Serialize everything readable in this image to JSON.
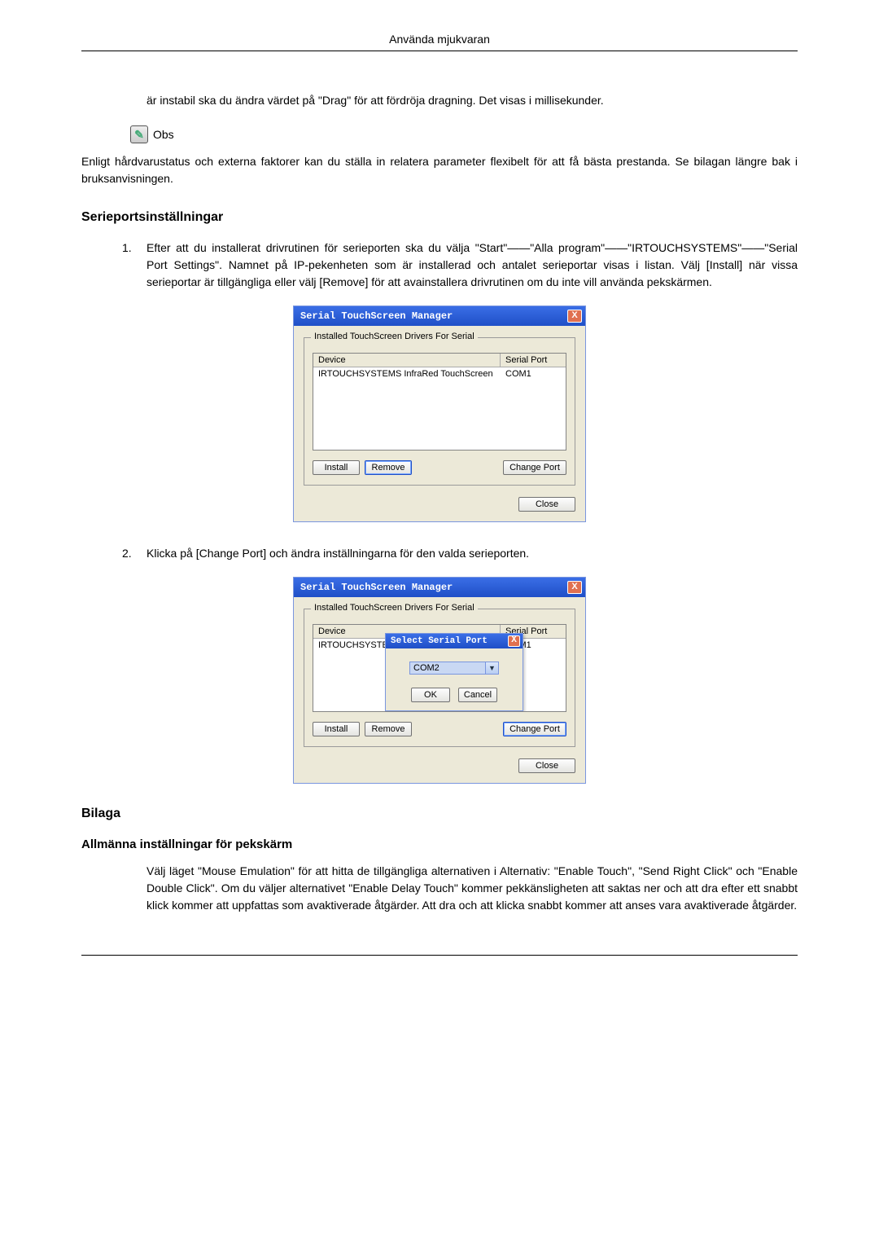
{
  "header": {
    "title": "Använda mjukvaran"
  },
  "intro_paragraph": "är instabil ska du ändra värdet på \"Drag\" för att fördröja dragning. Det visas i millisekunder.",
  "note": {
    "icon_glyph": "✎",
    "label": "Obs",
    "body": "Enligt hårdvarustatus och externa faktorer kan du ställa in relatera parameter flexibelt för att få bästa prestanda. Se bilagan längre bak i bruksanvisningen."
  },
  "section_serial": {
    "heading": "Serieportsinställningar",
    "item1_num": "1.",
    "item1_text": "Efter att du installerat drivrutinen för serieporten ska du välja \"Start\"——\"Alla program\"——\"IRTOUCHSYSTEMS\"——\"Serial Port Settings\". Namnet på IP-pekenheten som är installerad och antalet serieportar visas i listan. Välj [Install] när vissa serieportar är tillgängliga eller välj [Remove] för att avainstallera drivrutinen om du inte vill använda pekskärmen.",
    "item2_num": "2.",
    "item2_text": "Klicka på [Change Port] och ändra inställningarna för den valda serieporten."
  },
  "dialog1": {
    "title": "Serial TouchScreen Manager",
    "group_label": "Installed TouchScreen Drivers For Serial",
    "col_device": "Device",
    "col_port": "Serial Port",
    "row_device": "IRTOUCHSYSTEMS InfraRed TouchScreen",
    "row_port": "COM1",
    "btn_install": "Install",
    "btn_remove": "Remove",
    "btn_change": "Change Port",
    "btn_close": "Close",
    "close_x": "X"
  },
  "dialog2": {
    "title": "Serial TouchScreen Manager",
    "group_label": "Installed TouchScreen Drivers For Serial",
    "col_device": "Device",
    "col_port": "Serial Port",
    "row_device": "IRTOUCHSYSTE",
    "row_port": "COM1",
    "btn_install": "Install",
    "btn_remove": "Remove",
    "btn_change": "Change Port",
    "btn_close": "Close",
    "close_x": "X",
    "inner_title": "Select Serial Port",
    "inner_close_x": "X",
    "combo_value": "COM2",
    "combo_arrow": "▼",
    "btn_ok": "OK",
    "btn_cancel": "Cancel"
  },
  "bilaga": {
    "heading": "Bilaga",
    "subheading": "Allmänna inställningar för pekskärm",
    "body": "Välj läget \"Mouse Emulation\" för att hitta de tillgängliga alternativen i Alternativ: \"Enable Touch\", \"Send Right Click\" och \"Enable Double Click\". Om du väljer alternativet \"Enable Delay Touch\" kommer pekkänsligheten att saktas ner och att dra efter ett snabbt klick kommer att uppfattas som avaktiverade åtgärder. Att dra och att klicka snabbt kommer att anses vara avaktiverade åtgärder."
  }
}
